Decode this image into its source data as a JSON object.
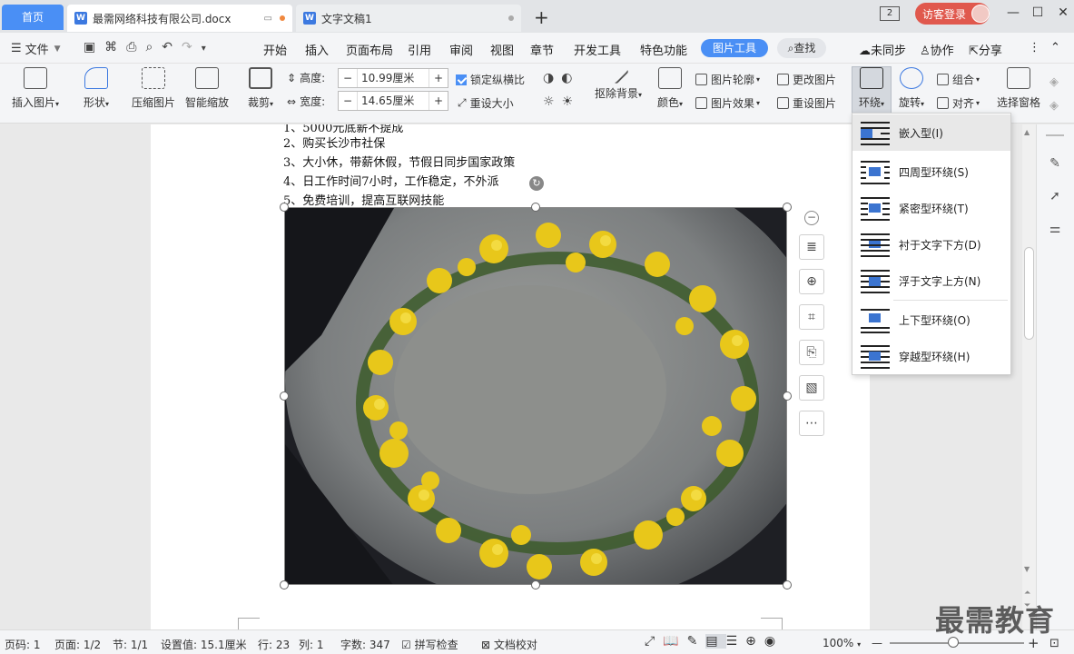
{
  "tabs": {
    "home": "首页",
    "active_doc": "最需网络科技有限公司.docx",
    "other_doc": "文字文稿1",
    "add": "+",
    "active_dot_color": "#f0883e",
    "other_dot_color": "#aaaaaa"
  },
  "titlebar": {
    "badge": "2",
    "login": "访客登录",
    "minimize": "—",
    "maximize": "☐",
    "close": "✕"
  },
  "menu": {
    "file": "文件",
    "items": [
      "开始",
      "插入",
      "页面布局",
      "引用",
      "审阅",
      "视图",
      "章节",
      "开发工具",
      "特色功能"
    ],
    "picture_tools": "图片工具",
    "search": "查找",
    "sync": "未同步",
    "collab": "协作",
    "share": "分享"
  },
  "ribbon": {
    "insert_picture": "插入图片",
    "shape": "形状",
    "compress": "压缩图片",
    "smart_scale": "智能缩放",
    "crop": "裁剪",
    "height_label": "高度:",
    "height_value": "10.99厘米",
    "width_label": "宽度:",
    "width_value": "14.65厘米",
    "lock_ratio": "锁定纵横比",
    "reset_size": "重设大小",
    "remove_bg": "抠除背景",
    "color": "颜色",
    "outline": "图片轮廓",
    "effects": "图片效果",
    "change_pic": "更改图片",
    "reset_pic": "重设图片",
    "wrap": "环绕",
    "rotate": "旋转",
    "group": "组合",
    "align": "对齐",
    "selection_pane": "选择窗格"
  },
  "document": {
    "lines": [
      "1、5000元底薪不提成",
      "2、购买长沙市社保",
      "3、大小休，带薪休假，节假日同步国家政策",
      "4、日工作时间7小时，工作稳定，不外派",
      "5、免费培训，提高互联网技能"
    ]
  },
  "wrap_menu": {
    "items": [
      {
        "label": "嵌入型(I)",
        "selected": true
      },
      {
        "label": "四周型环绕(S)",
        "selected": false
      },
      {
        "label": "紧密型环绕(T)",
        "selected": false
      },
      {
        "label": "衬于文字下方(D)",
        "selected": false
      },
      {
        "label": "浮于文字上方(N)",
        "selected": false
      },
      {
        "label": "上下型环绕(O)",
        "selected": false
      },
      {
        "label": "穿越型环绕(H)",
        "selected": false
      }
    ]
  },
  "statusbar": {
    "page_num": "页码: 1",
    "page": "页面: 1/2",
    "section": "节: 1/1",
    "setting": "设置值: 15.1厘米",
    "row": "行: 23",
    "col": "列: 1",
    "words": "字数: 347",
    "spell": "拼写检查",
    "proof": "文档校对",
    "zoom": "100%",
    "zoom_minus": "—",
    "zoom_plus": "+"
  },
  "watermark": "最需教育",
  "colors": {
    "accent": "#4a8ff5",
    "login_red": "#e0584d",
    "wrap_icon_blue": "#3b74d0"
  }
}
